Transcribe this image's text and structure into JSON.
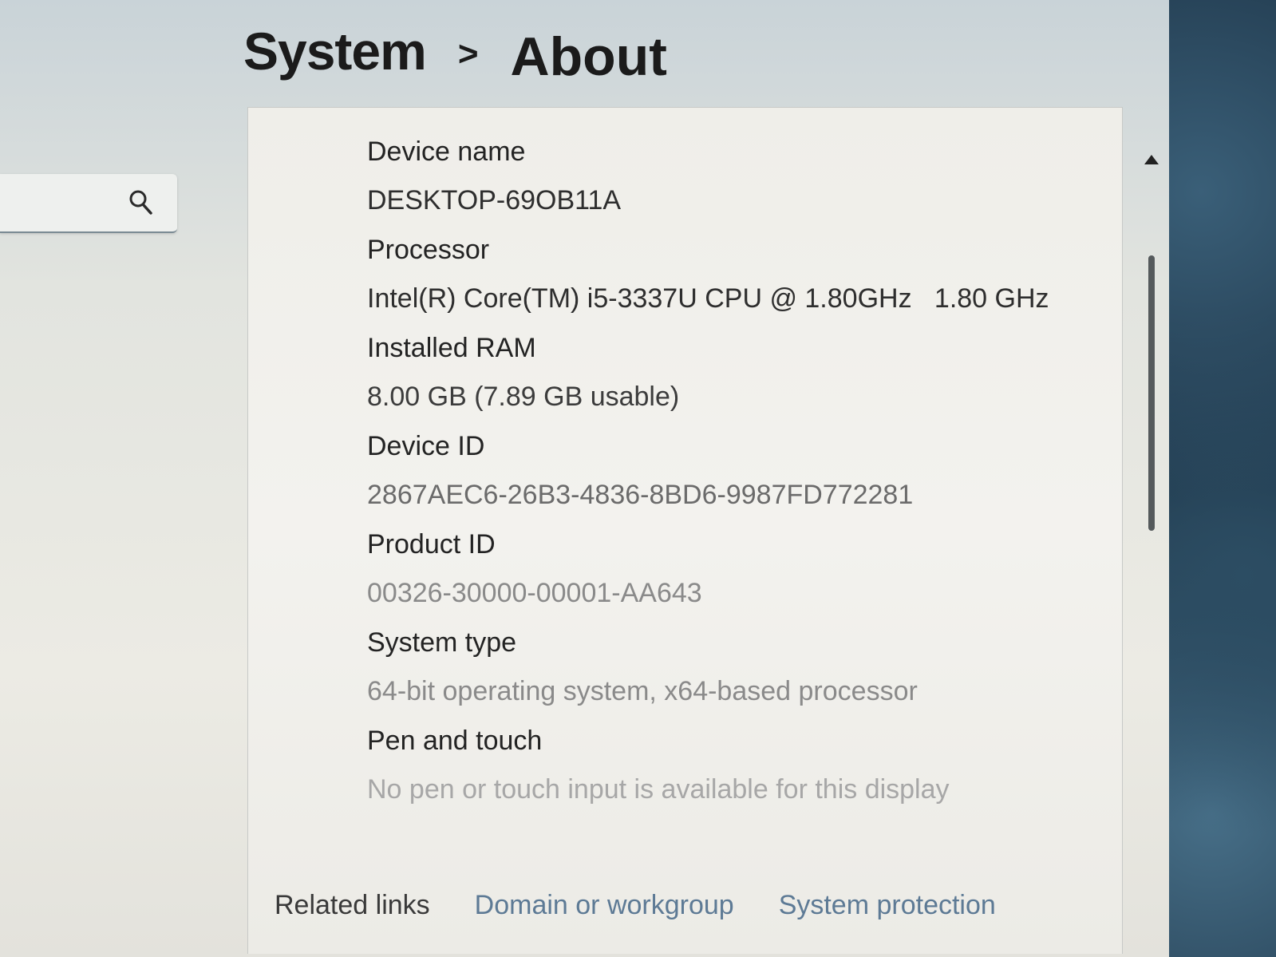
{
  "breadcrumb": {
    "parent": "System",
    "separator": ">",
    "current": "About"
  },
  "search": {
    "icon": "search-icon"
  },
  "specs": [
    {
      "label": "Device name",
      "value": "DESKTOP-69OB11A"
    },
    {
      "label": "Processor",
      "value": "Intel(R) Core(TM) i5-3337U CPU @ 1.80GHz   1.80 GHz"
    },
    {
      "label": "Installed RAM",
      "value": "8.00 GB (7.89 GB usable)"
    },
    {
      "label": "Device ID",
      "value": "2867AEC6-26B3-4836-8BD6-9987FD772281"
    },
    {
      "label": "Product ID",
      "value": "00326-30000-00001-AA643"
    },
    {
      "label": "System type",
      "value": "64-bit operating system, x64-based processor"
    },
    {
      "label": "Pen and touch",
      "value": "No pen or touch input is available for this display"
    }
  ],
  "related_links": {
    "title": "Related links",
    "links": [
      "Domain or workgroup",
      "System protection"
    ]
  },
  "colors": {
    "link": "#5d7a95",
    "text": "#232323"
  }
}
